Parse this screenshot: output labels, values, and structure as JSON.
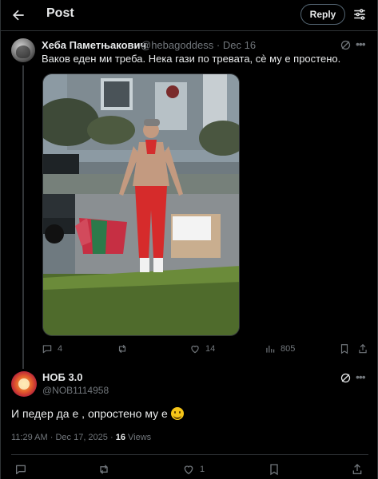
{
  "header": {
    "title": "Post",
    "reply_label": "Reply",
    "back_icon": "arrow-left-icon",
    "settings_icon": "settings-sliders-icon"
  },
  "parent_tweet": {
    "author_name": "Хеба Паметњакович",
    "handle": "@hebagoddess",
    "separator": "·",
    "date": "Dec 16",
    "text": "Ваков еден ми треба. Нека гази по тревата, сè му е простено.",
    "media_description_icon": "photo-icon",
    "stats": {
      "replies": "4",
      "reposts": "",
      "likes": "14",
      "views": "805"
    }
  },
  "main_tweet": {
    "author_name": "НОБ 3.0",
    "handle": "@NOB1114958",
    "text": "И педер да е , опростено му е",
    "emoji": "smiling-face-emoji",
    "time": "11:29 AM",
    "meta_separator": "·",
    "date": "Dec 17, 2025",
    "views_count": "16",
    "views_label": "Views",
    "stats": {
      "replies": "",
      "reposts": "",
      "likes": "1"
    }
  },
  "colors": {
    "background": "#000000",
    "text_primary": "#e7e9ea",
    "text_secondary": "#71767b",
    "divider": "#2f3336"
  }
}
